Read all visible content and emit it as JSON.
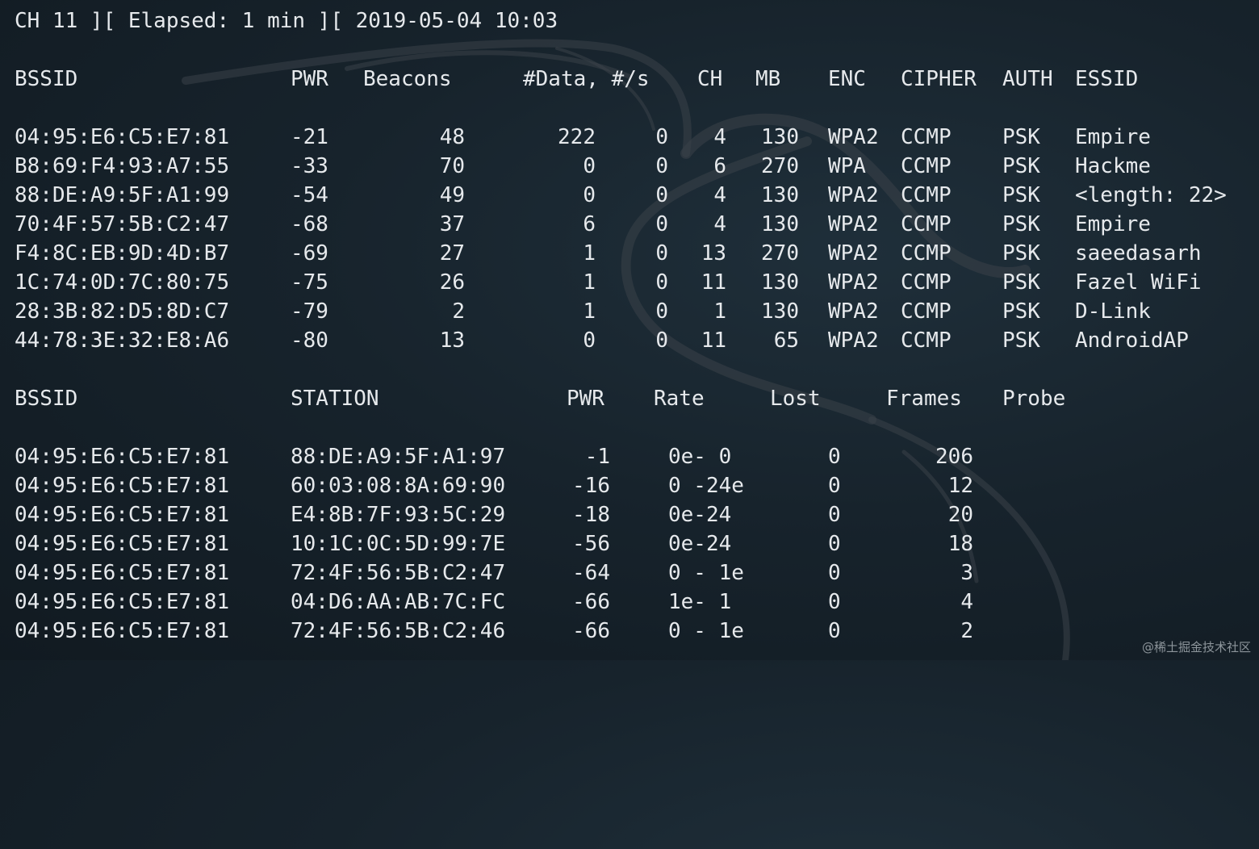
{
  "status_line": "CH 11 ][ Elapsed: 1 min ][ 2019-05-04 10:03",
  "ap_table": {
    "headers": {
      "bssid": "BSSID",
      "pwr": "PWR",
      "beacons": "Beacons",
      "data": "#Data, #/s",
      "ch": "CH",
      "mb": "MB",
      "enc": "ENC",
      "cipher": "CIPHER",
      "auth": "AUTH",
      "essid": "ESSID"
    },
    "rows": [
      {
        "bssid": "04:95:E6:C5:E7:81",
        "pwr": "-21",
        "beacons": "48",
        "data": "222",
        "rate": "0",
        "ch": "4",
        "mb": "130",
        "enc": "WPA2",
        "cipher": "CCMP",
        "auth": "PSK",
        "essid": "Empire"
      },
      {
        "bssid": "B8:69:F4:93:A7:55",
        "pwr": "-33",
        "beacons": "70",
        "data": "0",
        "rate": "0",
        "ch": "6",
        "mb": "270",
        "enc": "WPA",
        "cipher": "CCMP",
        "auth": "PSK",
        "essid": "Hackme"
      },
      {
        "bssid": "88:DE:A9:5F:A1:99",
        "pwr": "-54",
        "beacons": "49",
        "data": "0",
        "rate": "0",
        "ch": "4",
        "mb": "130",
        "enc": "WPA2",
        "cipher": "CCMP",
        "auth": "PSK",
        "essid": "<length: 22>"
      },
      {
        "bssid": "70:4F:57:5B:C2:47",
        "pwr": "-68",
        "beacons": "37",
        "data": "6",
        "rate": "0",
        "ch": "4",
        "mb": "130",
        "enc": "WPA2",
        "cipher": "CCMP",
        "auth": "PSK",
        "essid": "Empire"
      },
      {
        "bssid": "F4:8C:EB:9D:4D:B7",
        "pwr": "-69",
        "beacons": "27",
        "data": "1",
        "rate": "0",
        "ch": "13",
        "mb": "270",
        "enc": "WPA2",
        "cipher": "CCMP",
        "auth": "PSK",
        "essid": "saeedasarh"
      },
      {
        "bssid": "1C:74:0D:7C:80:75",
        "pwr": "-75",
        "beacons": "26",
        "data": "1",
        "rate": "0",
        "ch": "11",
        "mb": "130",
        "enc": "WPA2",
        "cipher": "CCMP",
        "auth": "PSK",
        "essid": "Fazel WiFi"
      },
      {
        "bssid": "28:3B:82:D5:8D:C7",
        "pwr": "-79",
        "beacons": "2",
        "data": "1",
        "rate": "0",
        "ch": "1",
        "mb": "130",
        "enc": "WPA2",
        "cipher": "CCMP",
        "auth": "PSK",
        "essid": "D-Link"
      },
      {
        "bssid": "44:78:3E:32:E8:A6",
        "pwr": "-80",
        "beacons": "13",
        "data": "0",
        "rate": "0",
        "ch": "11",
        "mb": "65",
        "enc": "WPA2",
        "cipher": "CCMP",
        "auth": "PSK",
        "essid": "AndroidAP"
      }
    ]
  },
  "station_table": {
    "headers": {
      "bssid": "BSSID",
      "station": "STATION",
      "pwr": "PWR",
      "rate": "Rate",
      "lost": "Lost",
      "frames": "Frames",
      "probe": "Probe"
    },
    "rows": [
      {
        "bssid": "04:95:E6:C5:E7:81",
        "station": "88:DE:A9:5F:A1:97",
        "pwr": "-1",
        "rate": "0e- 0",
        "lost": "0",
        "frames": "206"
      },
      {
        "bssid": "04:95:E6:C5:E7:81",
        "station": "60:03:08:8A:69:90",
        "pwr": "-16",
        "rate": "0 -24e",
        "lost": "0",
        "frames": "12"
      },
      {
        "bssid": "04:95:E6:C5:E7:81",
        "station": "E4:8B:7F:93:5C:29",
        "pwr": "-18",
        "rate": "0e-24",
        "lost": "0",
        "frames": "20"
      },
      {
        "bssid": "04:95:E6:C5:E7:81",
        "station": "10:1C:0C:5D:99:7E",
        "pwr": "-56",
        "rate": "0e-24",
        "lost": "0",
        "frames": "18"
      },
      {
        "bssid": "04:95:E6:C5:E7:81",
        "station": "72:4F:56:5B:C2:47",
        "pwr": "-64",
        "rate": "0 - 1e",
        "lost": "0",
        "frames": "3"
      },
      {
        "bssid": "04:95:E6:C5:E7:81",
        "station": "04:D6:AA:AB:7C:FC",
        "pwr": "-66",
        "rate": "1e- 1",
        "lost": "0",
        "frames": "4"
      },
      {
        "bssid": "04:95:E6:C5:E7:81",
        "station": "72:4F:56:5B:C2:46",
        "pwr": "-66",
        "rate": "0 - 1e",
        "lost": "0",
        "frames": "2"
      }
    ]
  },
  "site_watermark": "@稀土掘金技术社区",
  "colors": {
    "background": "#17232c",
    "text": "#e6e9ec",
    "watermark": "#8d959b"
  },
  "icons": {
    "background_logo": "kali-dragon-icon"
  }
}
